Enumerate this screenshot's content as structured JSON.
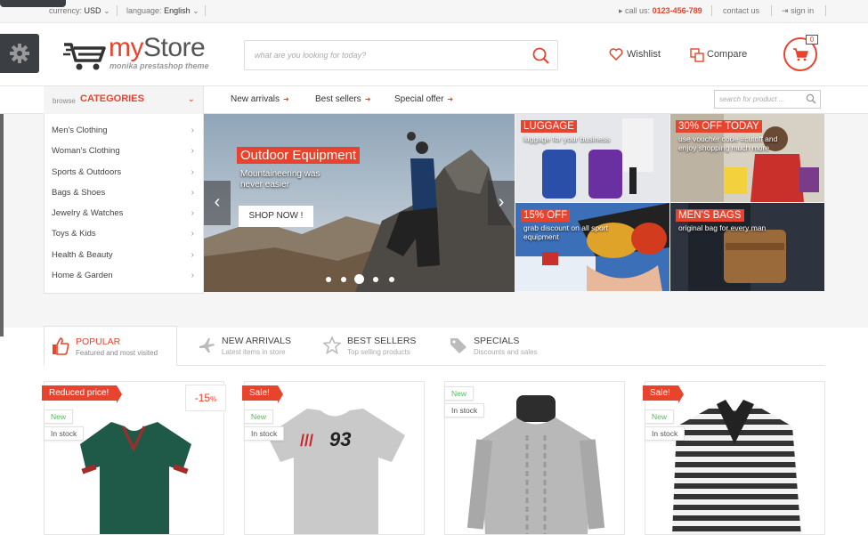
{
  "topbar": {
    "currency_label": "currency:",
    "currency_value": "USD",
    "language_label": "language:",
    "language_value": "English",
    "call_label": "call us:",
    "phone": "0123-456-789",
    "contact": "contact us",
    "signin": "sign in"
  },
  "header": {
    "logo_my": "my",
    "logo_store": "Store",
    "logo_sub": "monika prestashop theme",
    "search_placeholder": "what are you looking for today?",
    "wishlist": "Wishlist",
    "compare": "Compare",
    "cart_count": "0"
  },
  "nav": {
    "browse": "browse",
    "categories": "CATEGORIES",
    "items": [
      "New arrivals",
      "Best sellers",
      "Special offer"
    ],
    "search_placeholder": "search for product ..."
  },
  "sidebar": {
    "items": [
      "Men's Clothing",
      "Woman's Clothing",
      "Sports & Outdoors",
      "Bags & Shoes",
      "Jewelry & Watches",
      "Toys & Kids",
      "Health & Beauty",
      "Home & Garden"
    ]
  },
  "slider": {
    "title": "Outdoor Equipment",
    "subtitle": "Mountaineering was never easier",
    "button": "SHOP NOW !"
  },
  "banners": [
    {
      "title": "LUGGAGE",
      "sub": "luggage for your business"
    },
    {
      "title": "30% OFF TODAY",
      "sub": "use voucher code #cutoff and enjoy shopping much more"
    },
    {
      "title": "15% OFF",
      "sub": "grab discount on all sport equipment"
    },
    {
      "title": "MEN'S BAGS",
      "sub": "original bag for every man"
    }
  ],
  "tabs": [
    {
      "title": "POPULAR",
      "sub": "Featured and most visited"
    },
    {
      "title": "NEW ARRIVALS",
      "sub": "Latest items in store"
    },
    {
      "title": "BEST SELLERS",
      "sub": "Top selling products"
    },
    {
      "title": "SPECIALS",
      "sub": "Discounts and sales"
    }
  ],
  "products": [
    {
      "ribbon": "Reduced price!",
      "discount": "-15",
      "discount_unit": "%",
      "new": "New",
      "stock": "In stock"
    },
    {
      "ribbon": "Sale!",
      "new": "New",
      "stock": "In stock"
    },
    {
      "new": "New",
      "stock": "In stock"
    },
    {
      "ribbon": "Sale!",
      "new": "New",
      "stock": "In stock"
    }
  ],
  "colors": {
    "accent": "#e8432c",
    "new_green": "#5cb85c",
    "dark": "#3b3f44"
  }
}
